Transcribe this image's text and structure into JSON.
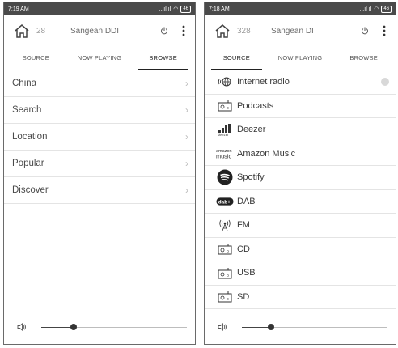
{
  "left": {
    "status": {
      "time": "7:19 AM",
      "battery": "46"
    },
    "header": {
      "number": "28",
      "device": "Sangean DDI"
    },
    "tabs": [
      "SOURCE",
      "NOW PLAYING",
      "BROWSE"
    ],
    "active_tab": 2,
    "browse_items": [
      {
        "label": "China"
      },
      {
        "label": "Search"
      },
      {
        "label": "Location"
      },
      {
        "label": "Popular"
      },
      {
        "label": "Discover"
      }
    ],
    "volume": {
      "level": 0.22
    }
  },
  "right": {
    "status": {
      "time": "7:18 AM",
      "battery": "46"
    },
    "header": {
      "number": "328",
      "device": "Sangean DI"
    },
    "tabs": [
      "SOURCE",
      "NOW PLAYING",
      "BROWSE"
    ],
    "active_tab": 0,
    "sources": [
      {
        "label": "Internet radio",
        "icon": "internet-radio-icon"
      },
      {
        "label": "Podcasts",
        "icon": "podcasts-icon"
      },
      {
        "label": "Deezer",
        "icon": "deezer-icon"
      },
      {
        "label": "Amazon Music",
        "icon": "amazon-music-icon"
      },
      {
        "label": "Spotify",
        "icon": "spotify-icon"
      },
      {
        "label": "DAB",
        "icon": "dab-icon"
      },
      {
        "label": "FM",
        "icon": "fm-icon"
      },
      {
        "label": "CD",
        "icon": "cd-icon"
      },
      {
        "label": "USB",
        "icon": "usb-icon"
      },
      {
        "label": "SD",
        "icon": "sd-icon"
      }
    ],
    "volume": {
      "level": 0.2
    }
  },
  "logos": {
    "deezer": "deezer",
    "amazon_top": "amazon",
    "amazon_bottom": "music",
    "dab": "dab+"
  }
}
